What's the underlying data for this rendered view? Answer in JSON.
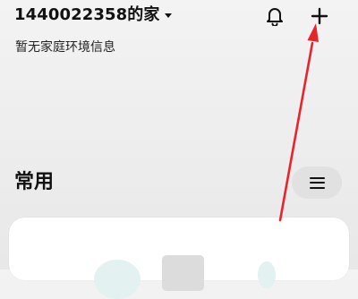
{
  "header": {
    "home_title": "1440022358的家",
    "dropdown_icon": "caret-down-icon"
  },
  "actions": {
    "bell_icon": "bell-icon",
    "add_icon": "plus-icon"
  },
  "environment": {
    "status_text": "暂无家庭环境信息"
  },
  "section": {
    "title": "常用",
    "menu_icon": "menu-icon"
  },
  "annotation": {
    "color": "#e8242b"
  }
}
